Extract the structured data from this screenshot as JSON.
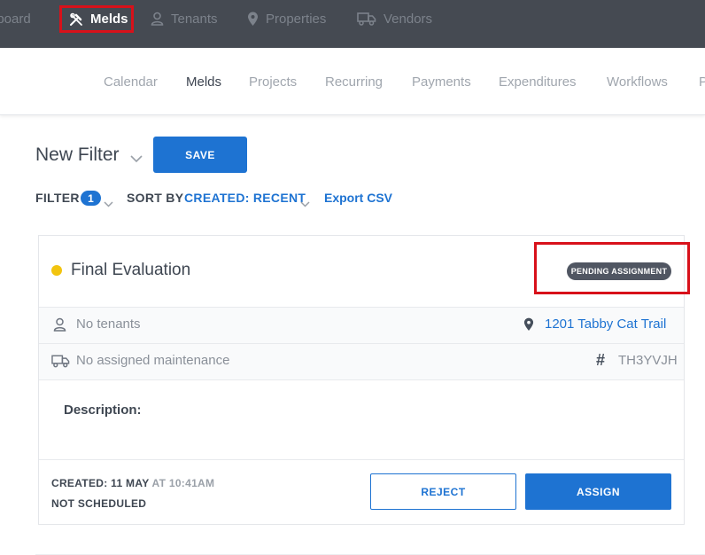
{
  "topnav": {
    "items": [
      {
        "label": "nboard",
        "icon": "dashboard-icon"
      },
      {
        "label": "Melds",
        "icon": "tools-icon",
        "active": true
      },
      {
        "label": "Tenants",
        "icon": "person-icon"
      },
      {
        "label": "Properties",
        "icon": "location-pin-icon"
      },
      {
        "label": "Vendors",
        "icon": "truck-icon"
      }
    ]
  },
  "subnav": {
    "items": [
      {
        "label": "Calendar"
      },
      {
        "label": "Melds",
        "active": true
      },
      {
        "label": "Projects"
      },
      {
        "label": "Recurring"
      },
      {
        "label": "Payments"
      },
      {
        "label": "Expenditures"
      },
      {
        "label": "Workflows"
      },
      {
        "label": "P"
      }
    ]
  },
  "filter": {
    "title": "New Filter",
    "save_label": "SAVE",
    "filter_label": "FILTER",
    "filter_count": "1",
    "sort_label": "SORT BY",
    "sort_value": "CREATED: RECENT",
    "export_label": "Export CSV"
  },
  "meld": {
    "title": "Final Evaluation",
    "status": "PENDING ASSIGNMENT",
    "status_dot_color": "#f2c40f",
    "tenants": "No tenants",
    "address": "1201 Tabby Cat Trail",
    "maintenance": "No assigned maintenance",
    "meld_id": "TH3YVJH",
    "description_label": "Description:",
    "created_prefix": "CREATED: 11 MAY",
    "created_time": "AT 10:41AM",
    "schedule": "NOT SCHEDULED",
    "reject_label": "REJECT",
    "assign_label": "ASSIGN"
  },
  "colors": {
    "accent": "#1e73d2",
    "topnav_bg": "#454a52",
    "highlight": "#d8111a"
  }
}
